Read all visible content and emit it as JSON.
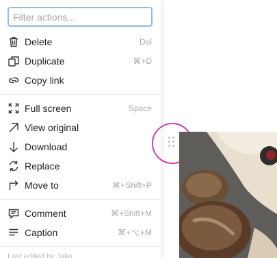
{
  "filter": {
    "placeholder": "Filter actions..."
  },
  "groups": [
    {
      "items": [
        {
          "icon": "trash-icon",
          "label": "Delete",
          "shortcut": "Del"
        },
        {
          "icon": "duplicate-icon",
          "label": "Duplicate",
          "shortcut": "⌘+D"
        },
        {
          "icon": "link-icon",
          "label": "Copy link",
          "shortcut": ""
        }
      ]
    },
    {
      "items": [
        {
          "icon": "fullscreen-icon",
          "label": "Full screen",
          "shortcut": "Space"
        },
        {
          "icon": "arrow-up-right-icon",
          "label": "View original",
          "shortcut": ""
        },
        {
          "icon": "arrow-down-icon",
          "label": "Download",
          "shortcut": ""
        },
        {
          "icon": "replace-icon",
          "label": "Replace",
          "shortcut": ""
        },
        {
          "icon": "move-to-icon",
          "label": "Move to",
          "shortcut": "⌘+Shift+P"
        }
      ]
    },
    {
      "items": [
        {
          "icon": "comment-icon",
          "label": "Comment",
          "shortcut": "⌘+Shift+M"
        },
        {
          "icon": "caption-icon",
          "label": "Caption",
          "shortcut": "⌘+⌥+M"
        }
      ]
    }
  ],
  "footer": {
    "text": "Last edited by Jake"
  },
  "colors": {
    "focus_ring": "#8dbfe6",
    "highlight": "#d23fb6"
  }
}
